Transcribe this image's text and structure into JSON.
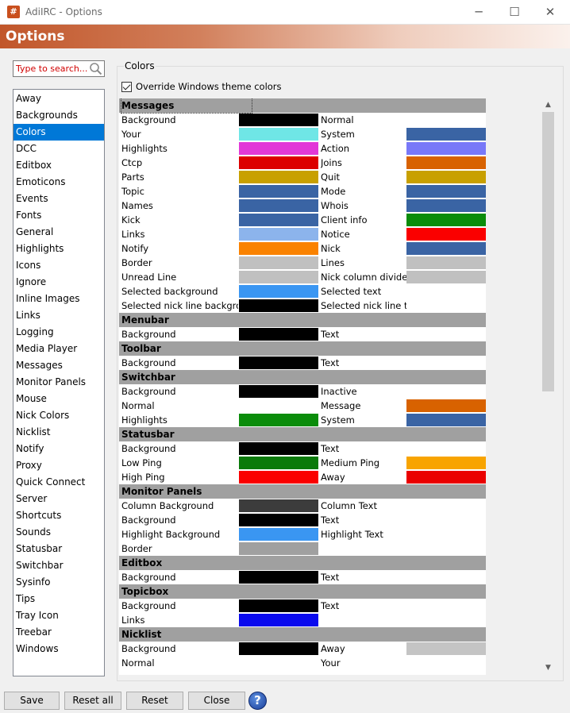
{
  "window": {
    "title": "AdiIRC - Options",
    "app_icon": "#",
    "minimize_glyph": "─",
    "maximize_glyph": "☐",
    "close_glyph": "✕"
  },
  "header": {
    "title": "Options"
  },
  "search": {
    "placeholder": "Type to search..."
  },
  "categories": {
    "selected": "Colors",
    "items": [
      "Away",
      "Backgrounds",
      "Colors",
      "DCC",
      "Editbox",
      "Emoticons",
      "Events",
      "Fonts",
      "General",
      "Highlights",
      "Icons",
      "Ignore",
      "Inline Images",
      "Links",
      "Logging",
      "Media Player",
      "Messages",
      "Monitor Panels",
      "Mouse",
      "Nick Colors",
      "Nicklist",
      "Notify",
      "Proxy",
      "Quick Connect",
      "Server",
      "Shortcuts",
      "Sounds",
      "Statusbar",
      "Switchbar",
      "Sysinfo",
      "Tips",
      "Tray Icon",
      "Treebar",
      "Windows"
    ]
  },
  "colors_panel": {
    "legend": "Colors",
    "override_label": "Override Windows theme colors",
    "override_checked": true
  },
  "color_sections": [
    {
      "title": "Messages",
      "rows": [
        {
          "left": "Background",
          "left_color": "#000000",
          "right": "Normal",
          "right_color": null
        },
        {
          "left": "Your",
          "left_color": "#6fe6e6",
          "right": "System",
          "right_color": "#3a64a4"
        },
        {
          "left": "Highlights",
          "left_color": "#e238d8",
          "right": "Action",
          "right_color": "#7878f8"
        },
        {
          "left": "Ctcp",
          "left_color": "#dc0000",
          "right": "Joins",
          "right_color": "#d86200"
        },
        {
          "left": "Parts",
          "left_color": "#c8a000",
          "right": "Quit",
          "right_color": "#c8a000"
        },
        {
          "left": "Topic",
          "left_color": "#3a64a4",
          "right": "Mode",
          "right_color": "#3a64a4"
        },
        {
          "left": "Names",
          "left_color": "#3a64a4",
          "right": "Whois",
          "right_color": "#3a64a4"
        },
        {
          "left": "Kick",
          "left_color": "#3a64a4",
          "right": "Client info",
          "right_color": "#0a8c0a"
        },
        {
          "left": "Links",
          "left_color": "#8cb4ec",
          "right": "Notice",
          "right_color": "#fa0000"
        },
        {
          "left": "Notify",
          "left_color": "#fa8200",
          "right": "Nick",
          "right_color": "#3a64a4"
        },
        {
          "left": "Border",
          "left_color": "#c0c0c0",
          "right": "Lines",
          "right_color": "#c0c0c0"
        },
        {
          "left": "Unread Line",
          "left_color": "#c0c0c0",
          "right": "Nick column divider",
          "right_color": "#c0c0c0"
        },
        {
          "left": "Selected background",
          "left_color": "#3a96f2",
          "right": "Selected text",
          "right_color": null
        },
        {
          "left": "Selected nick line background",
          "left_color": "#000000",
          "right": "Selected nick line text",
          "right_color": null
        }
      ]
    },
    {
      "title": "Menubar",
      "rows": [
        {
          "left": "Background",
          "left_color": "#000000",
          "right": "Text",
          "right_color": null
        }
      ]
    },
    {
      "title": "Toolbar",
      "rows": [
        {
          "left": "Background",
          "left_color": "#000000",
          "right": "Text",
          "right_color": null
        }
      ]
    },
    {
      "title": "Switchbar",
      "rows": [
        {
          "left": "Background",
          "left_color": "#000000",
          "right": "Inactive",
          "right_color": null
        },
        {
          "left": "Normal",
          "left_color": null,
          "right": "Message",
          "right_color": "#d86200"
        },
        {
          "left": "Highlights",
          "left_color": "#0a8c0a",
          "right": "System",
          "right_color": "#3a64a4"
        }
      ]
    },
    {
      "title": "Statusbar",
      "rows": [
        {
          "left": "Background",
          "left_color": "#000000",
          "right": "Text",
          "right_color": null
        },
        {
          "left": "Low Ping",
          "left_color": "#0a7a0a",
          "right": "Medium Ping",
          "right_color": "#f8a400"
        },
        {
          "left": "High Ping",
          "left_color": "#fa0000",
          "right": "Away",
          "right_color": "#ea0000"
        }
      ]
    },
    {
      "title": "Monitor Panels",
      "rows": [
        {
          "left": "Column Background",
          "left_color": "#3c3c3c",
          "right": "Column Text",
          "right_color": null
        },
        {
          "left": "Background",
          "left_color": "#000000",
          "right": "Text",
          "right_color": null
        },
        {
          "left": "Highlight Background",
          "left_color": "#3a96f2",
          "right": "Highlight Text",
          "right_color": null
        },
        {
          "left": "Border",
          "left_color": "#a0a0a0",
          "right": "",
          "right_color": null
        }
      ]
    },
    {
      "title": "Editbox",
      "rows": [
        {
          "left": "Background",
          "left_color": "#000000",
          "right": "Text",
          "right_color": null
        }
      ]
    },
    {
      "title": "Topicbox",
      "rows": [
        {
          "left": "Background",
          "left_color": "#000000",
          "right": "Text",
          "right_color": null
        },
        {
          "left": "Links",
          "left_color": "#0a0aee",
          "right": "",
          "right_color": null
        }
      ]
    },
    {
      "title": "Nicklist",
      "rows": [
        {
          "left": "Background",
          "left_color": "#000000",
          "right": "Away",
          "right_color": "#c4c4c4"
        },
        {
          "left": "Normal",
          "left_color": null,
          "right": "Your",
          "right_color": null
        }
      ]
    }
  ],
  "scrollbar": {
    "up_glyph": "▲",
    "down_glyph": "▼"
  },
  "buttons": {
    "save": "Save",
    "reset_all": "Reset all",
    "reset": "Reset",
    "close": "Close",
    "help_glyph": "?"
  }
}
